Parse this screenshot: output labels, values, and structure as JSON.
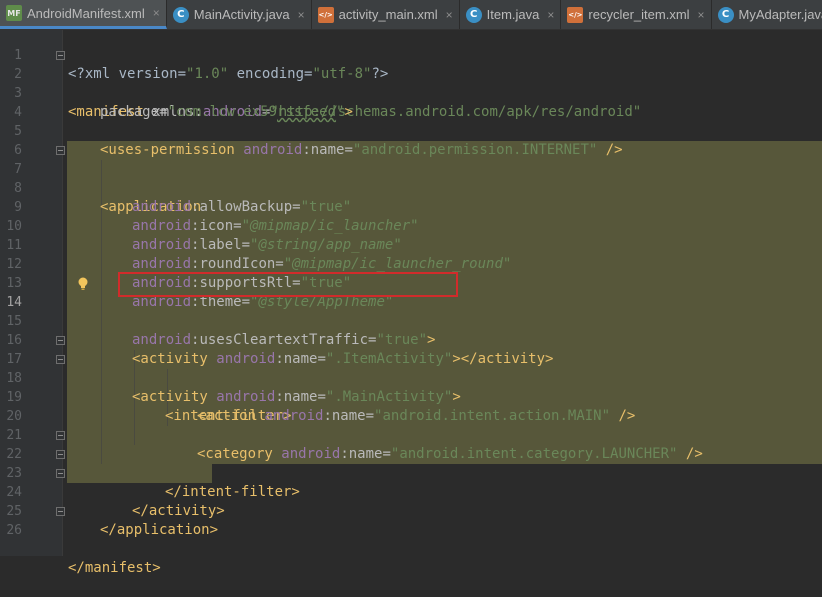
{
  "tabs": [
    {
      "label": "AndroidManifest.xml",
      "icon": "manifest-file-icon",
      "active": true
    },
    {
      "label": "MainActivity.java",
      "icon": "java-class-icon",
      "active": false
    },
    {
      "label": "activity_main.xml",
      "icon": "xml-layout-icon",
      "active": false
    },
    {
      "label": "Item.java",
      "icon": "java-class-icon",
      "active": false
    },
    {
      "label": "recycler_item.xml",
      "icon": "xml-layout-icon",
      "active": false
    },
    {
      "label": "MyAdapter.java",
      "icon": "java-class-icon",
      "active": false
    }
  ],
  "close_glyph": "×",
  "line_numbers": [
    "1",
    "2",
    "3",
    "4",
    "5",
    "6",
    "7",
    "8",
    "9",
    "10",
    "11",
    "12",
    "13",
    "14",
    "15",
    "16",
    "17",
    "18",
    "19",
    "20",
    "21",
    "22",
    "23",
    "24",
    "25",
    "26"
  ],
  "code": {
    "l1": {
      "a": "<?xml version=",
      "b": "\"1.0\"",
      "c": " encoding=",
      "d": "\"utf-8\"",
      "e": "?>"
    },
    "l2": {
      "a": "<manifest ",
      "ns": "xmlns:",
      "b": "android",
      "c": "=",
      "d": "\"http://schemas.android.com/apk/res/android\""
    },
    "l3": {
      "a": "package=",
      "b": "\"com.lcw.ex59",
      "c": "rssfeed",
      "d": "\"",
      "e": ">"
    },
    "l5": {
      "a": "<uses-permission ",
      "ns": "android",
      "b": ":name=",
      "c": "\"android.permission.INTERNET\"",
      "d": " />"
    },
    "l7": {
      "a": "<application"
    },
    "l8": {
      "ns": "android",
      "a": ":allowBackup=",
      "b": "\"true\""
    },
    "l9": {
      "ns": "android",
      "a": ":icon=",
      "b": "\"@mipmap/ic_launcher\""
    },
    "l10": {
      "ns": "android",
      "a": ":label=",
      "b": "\"@string/app_name\""
    },
    "l11": {
      "ns": "android",
      "a": ":roundIcon=",
      "b": "\"@mipmap/ic_launcher_round\""
    },
    "l12": {
      "ns": "android",
      "a": ":supportsRtl=",
      "b": "\"true\""
    },
    "l13": {
      "ns": "android",
      "a": ":theme=",
      "b": "\"@style/AppTheme\""
    },
    "l14": {
      "ns": "android",
      "a": ":usesCleartextTraffic=",
      "b": "\"true\"",
      "c": ">"
    },
    "l16": {
      "a": "<activity ",
      "ns": "android",
      "b": ":name=",
      "c": "\".ItemActivity\"",
      "d": "></activity>"
    },
    "l17": {
      "a": "<activity ",
      "ns": "android",
      "b": ":name=",
      "c": "\".MainActivity\"",
      "d": ">"
    },
    "l18": {
      "a": "<intent-filter>"
    },
    "l19": {
      "a": "<action ",
      "ns": "android",
      "b": ":name=",
      "c": "\"android.intent.action.MAIN\"",
      "d": " />"
    },
    "l21": {
      "a": "<category ",
      "ns": "android",
      "b": ":name=",
      "c": "\"android.intent.category.LAUNCHER\"",
      "d": " />"
    },
    "l22": {
      "a": "</intent-filter>"
    },
    "l23": {
      "a": "</activity>"
    },
    "l24": {
      "a": "</application>"
    },
    "l26": {
      "a": "</manifest>"
    }
  },
  "current_line": "14",
  "colors": {
    "tag": "#e8bf6a",
    "namespace": "#9876aa",
    "value": "#6a8759",
    "highlight": "#57573a",
    "annotation": "#d12b2b",
    "background": "#2b2b2b"
  }
}
